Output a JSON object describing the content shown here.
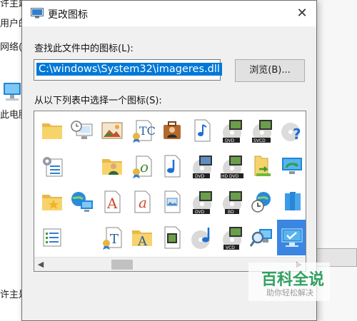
{
  "background": {
    "texts": [
      "许主题",
      "用户的",
      "网络(",
      "此电脑",
      "许主是"
    ],
    "computer_icon": "computer-icon"
  },
  "dialog": {
    "title": "更改图标",
    "close_label": "✕",
    "find_label": "查找此文件中的图标(L):",
    "path_value": "C:\\windows\\System32\\imageres.dll",
    "browse_label": "浏览(B)...",
    "pick_label": "从以下列表中选择一个图标(S):",
    "icons": [
      [
        "folder-icon",
        "desktop-preview-icon",
        "photo-gallery-icon",
        "font-certificate-icon",
        "user-briefcase-icon",
        "music-file-icon",
        "dvd-film-icon",
        "svcd-disc-icon",
        "help-disc-icon"
      ],
      [
        "settings-list-icon",
        "blank-icon",
        "user-folder-icon",
        "font-certificate-o-icon",
        "music-note-icon",
        "dvd-disc-icon",
        "hd-dvd-disc-icon",
        "folder-arrow-icon",
        "sync-monitor-icon"
      ],
      [
        "favorite-folder-icon",
        "network-globe-icon",
        "font-a-icon",
        "font-a-italic-icon",
        "image-file-icon",
        "dvd-disc-film-icon",
        "bd-disc-icon",
        "globe-clock-icon",
        "library-books-icon"
      ],
      [
        "checklist-icon",
        "blank-icon",
        "font-t-certificate-icon",
        "font-a-folder-icon",
        "video-file-icon",
        "music-disc-icon",
        "vcd-disc-icon",
        "search-computer-icon",
        "computer-check-icon"
      ]
    ],
    "selected_icon": "computer-check-icon",
    "scroll_left": "◀",
    "scroll_right": "▶"
  },
  "watermark": {
    "main": "百科全说",
    "sub": "助你轻松解决"
  },
  "colors": {
    "accent": "#0078d7",
    "selection": "#3a86e2",
    "watermark_green": "#2fa15f"
  }
}
